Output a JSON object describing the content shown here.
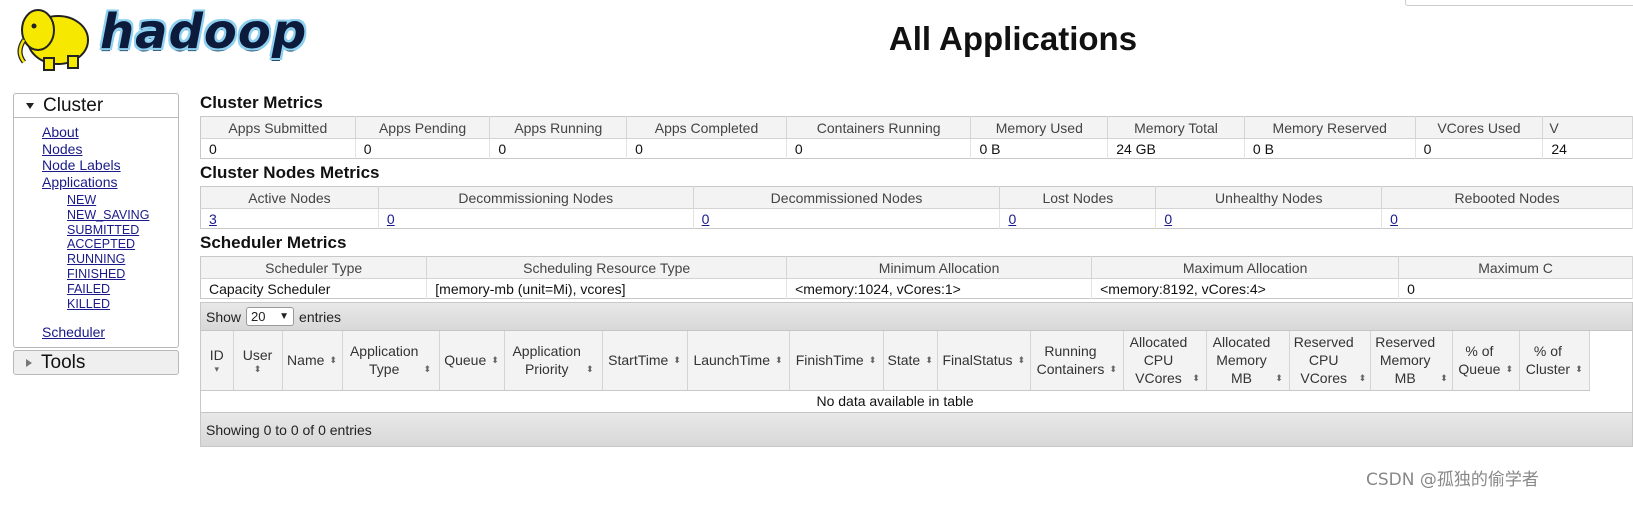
{
  "header": {
    "logo_text": "hadoop",
    "title": "All Applications"
  },
  "sidebar": {
    "cluster_label": "Cluster",
    "links": [
      "About",
      "Nodes",
      "Node Labels",
      "Applications"
    ],
    "app_states": [
      "NEW",
      "NEW_SAVING",
      "SUBMITTED",
      "ACCEPTED",
      "RUNNING",
      "FINISHED",
      "FAILED",
      "KILLED"
    ],
    "scheduler": "Scheduler",
    "tools_label": "Tools"
  },
  "cluster_metrics": {
    "title": "Cluster Metrics",
    "headers": [
      "Apps Submitted",
      "Apps Pending",
      "Apps Running",
      "Apps Completed",
      "Containers Running",
      "Memory Used",
      "Memory Total",
      "Memory Reserved",
      "VCores Used",
      "V"
    ],
    "values": [
      "0",
      "0",
      "0",
      "0",
      "0",
      "0 B",
      "24 GB",
      "0 B",
      "0",
      "24"
    ]
  },
  "node_metrics": {
    "title": "Cluster Nodes Metrics",
    "headers": [
      "Active Nodes",
      "Decommissioning Nodes",
      "Decommissioned Nodes",
      "Lost Nodes",
      "Unhealthy Nodes",
      "Rebooted Nodes"
    ],
    "values": [
      "3",
      "0",
      "0",
      "0",
      "0",
      "0"
    ]
  },
  "scheduler_metrics": {
    "title": "Scheduler Metrics",
    "headers": [
      "Scheduler Type",
      "Scheduling Resource Type",
      "Minimum Allocation",
      "Maximum Allocation",
      "Maximum C"
    ],
    "values": [
      "Capacity Scheduler",
      "[memory-mb (unit=Mi), vcores]",
      "<memory:1024, vCores:1>",
      "<memory:8192, vCores:4>",
      "0"
    ]
  },
  "apps": {
    "show_label": "Show",
    "page_size": "20",
    "entries_label": "entries",
    "columns": [
      {
        "label": "ID",
        "lines": [
          "ID"
        ]
      },
      {
        "label": "User",
        "lines": [
          "User"
        ]
      },
      {
        "label": "Name",
        "lines": [
          "Name"
        ]
      },
      {
        "label": "Application Type",
        "lines": [
          "Application",
          "Type"
        ]
      },
      {
        "label": "Queue",
        "lines": [
          "Queue"
        ]
      },
      {
        "label": "Application Priority",
        "lines": [
          "Application",
          "Priority"
        ]
      },
      {
        "label": "StartTime",
        "lines": [
          "StartTime"
        ]
      },
      {
        "label": "LaunchTime",
        "lines": [
          "LaunchTime"
        ]
      },
      {
        "label": "FinishTime",
        "lines": [
          "FinishTime"
        ]
      },
      {
        "label": "State",
        "lines": [
          "State"
        ]
      },
      {
        "label": "FinalStatus",
        "lines": [
          "FinalStatus"
        ]
      },
      {
        "label": "Running Containers",
        "lines": [
          "Running",
          "Containers"
        ]
      },
      {
        "label": "Allocated CPU VCores",
        "lines": [
          "Allocated",
          "CPU",
          "VCores"
        ]
      },
      {
        "label": "Allocated Memory MB",
        "lines": [
          "Allocated",
          "Memory",
          "MB"
        ]
      },
      {
        "label": "Reserved CPU VCores",
        "lines": [
          "Reserved",
          "CPU",
          "VCores"
        ]
      },
      {
        "label": "Reserved Memory MB",
        "lines": [
          "Reserved",
          "Memory",
          "MB"
        ]
      },
      {
        "label": "% of Queue",
        "lines": [
          "% of",
          "Queue"
        ]
      },
      {
        "label": "% of Cluster",
        "lines": [
          "% of",
          "Cluster"
        ]
      }
    ],
    "empty_message": "No data available in table",
    "footer": "Showing 0 to 0 of 0 entries"
  },
  "watermark": "CSDN @孤独的偷学者"
}
